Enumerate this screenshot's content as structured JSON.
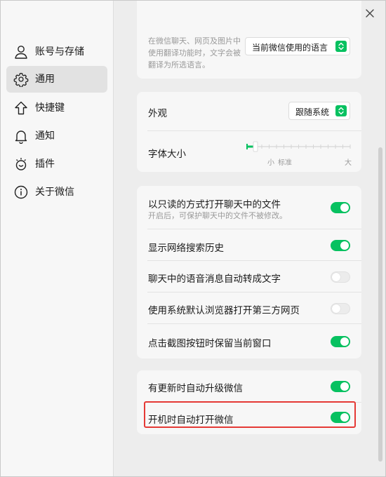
{
  "sidebar": {
    "items": [
      {
        "label": "账号与存储",
        "icon": "person-icon"
      },
      {
        "label": "通用",
        "icon": "gear-icon",
        "active": true
      },
      {
        "label": "快捷键",
        "icon": "shortcut-icon"
      },
      {
        "label": "通知",
        "icon": "bell-icon"
      },
      {
        "label": "插件",
        "icon": "plugin-icon"
      },
      {
        "label": "关于微信",
        "icon": "info-icon"
      }
    ]
  },
  "translate": {
    "description": "在微信聊天、网页及图片中使用翻译功能时，文字会被翻译为所选语言。",
    "dropdown_value": "当前微信使用的语言"
  },
  "appearance": {
    "label": "外观",
    "value": "跟随系统",
    "font_size_label": "字体大小",
    "slider_small": "小",
    "slider_standard": "标准",
    "slider_large": "大"
  },
  "chat_settings": [
    {
      "label": "以只读的方式打开聊天中的文件",
      "sub": "开启后，可保护聊天中的文件不被修改。",
      "on": true
    },
    {
      "label": "显示网络搜索历史",
      "on": true
    },
    {
      "label": "聊天中的语音消息自动转成文字",
      "on": false
    },
    {
      "label": "使用系统默认浏览器打开第三方网页",
      "on": false
    },
    {
      "label": "点击截图按钮时保留当前窗口",
      "on": true
    }
  ],
  "update_settings": [
    {
      "label": "有更新时自动升级微信",
      "on": true
    },
    {
      "label": "开机时自动打开微信",
      "on": true
    }
  ],
  "colors": {
    "accent": "#07c160",
    "highlight": "#e53935"
  }
}
